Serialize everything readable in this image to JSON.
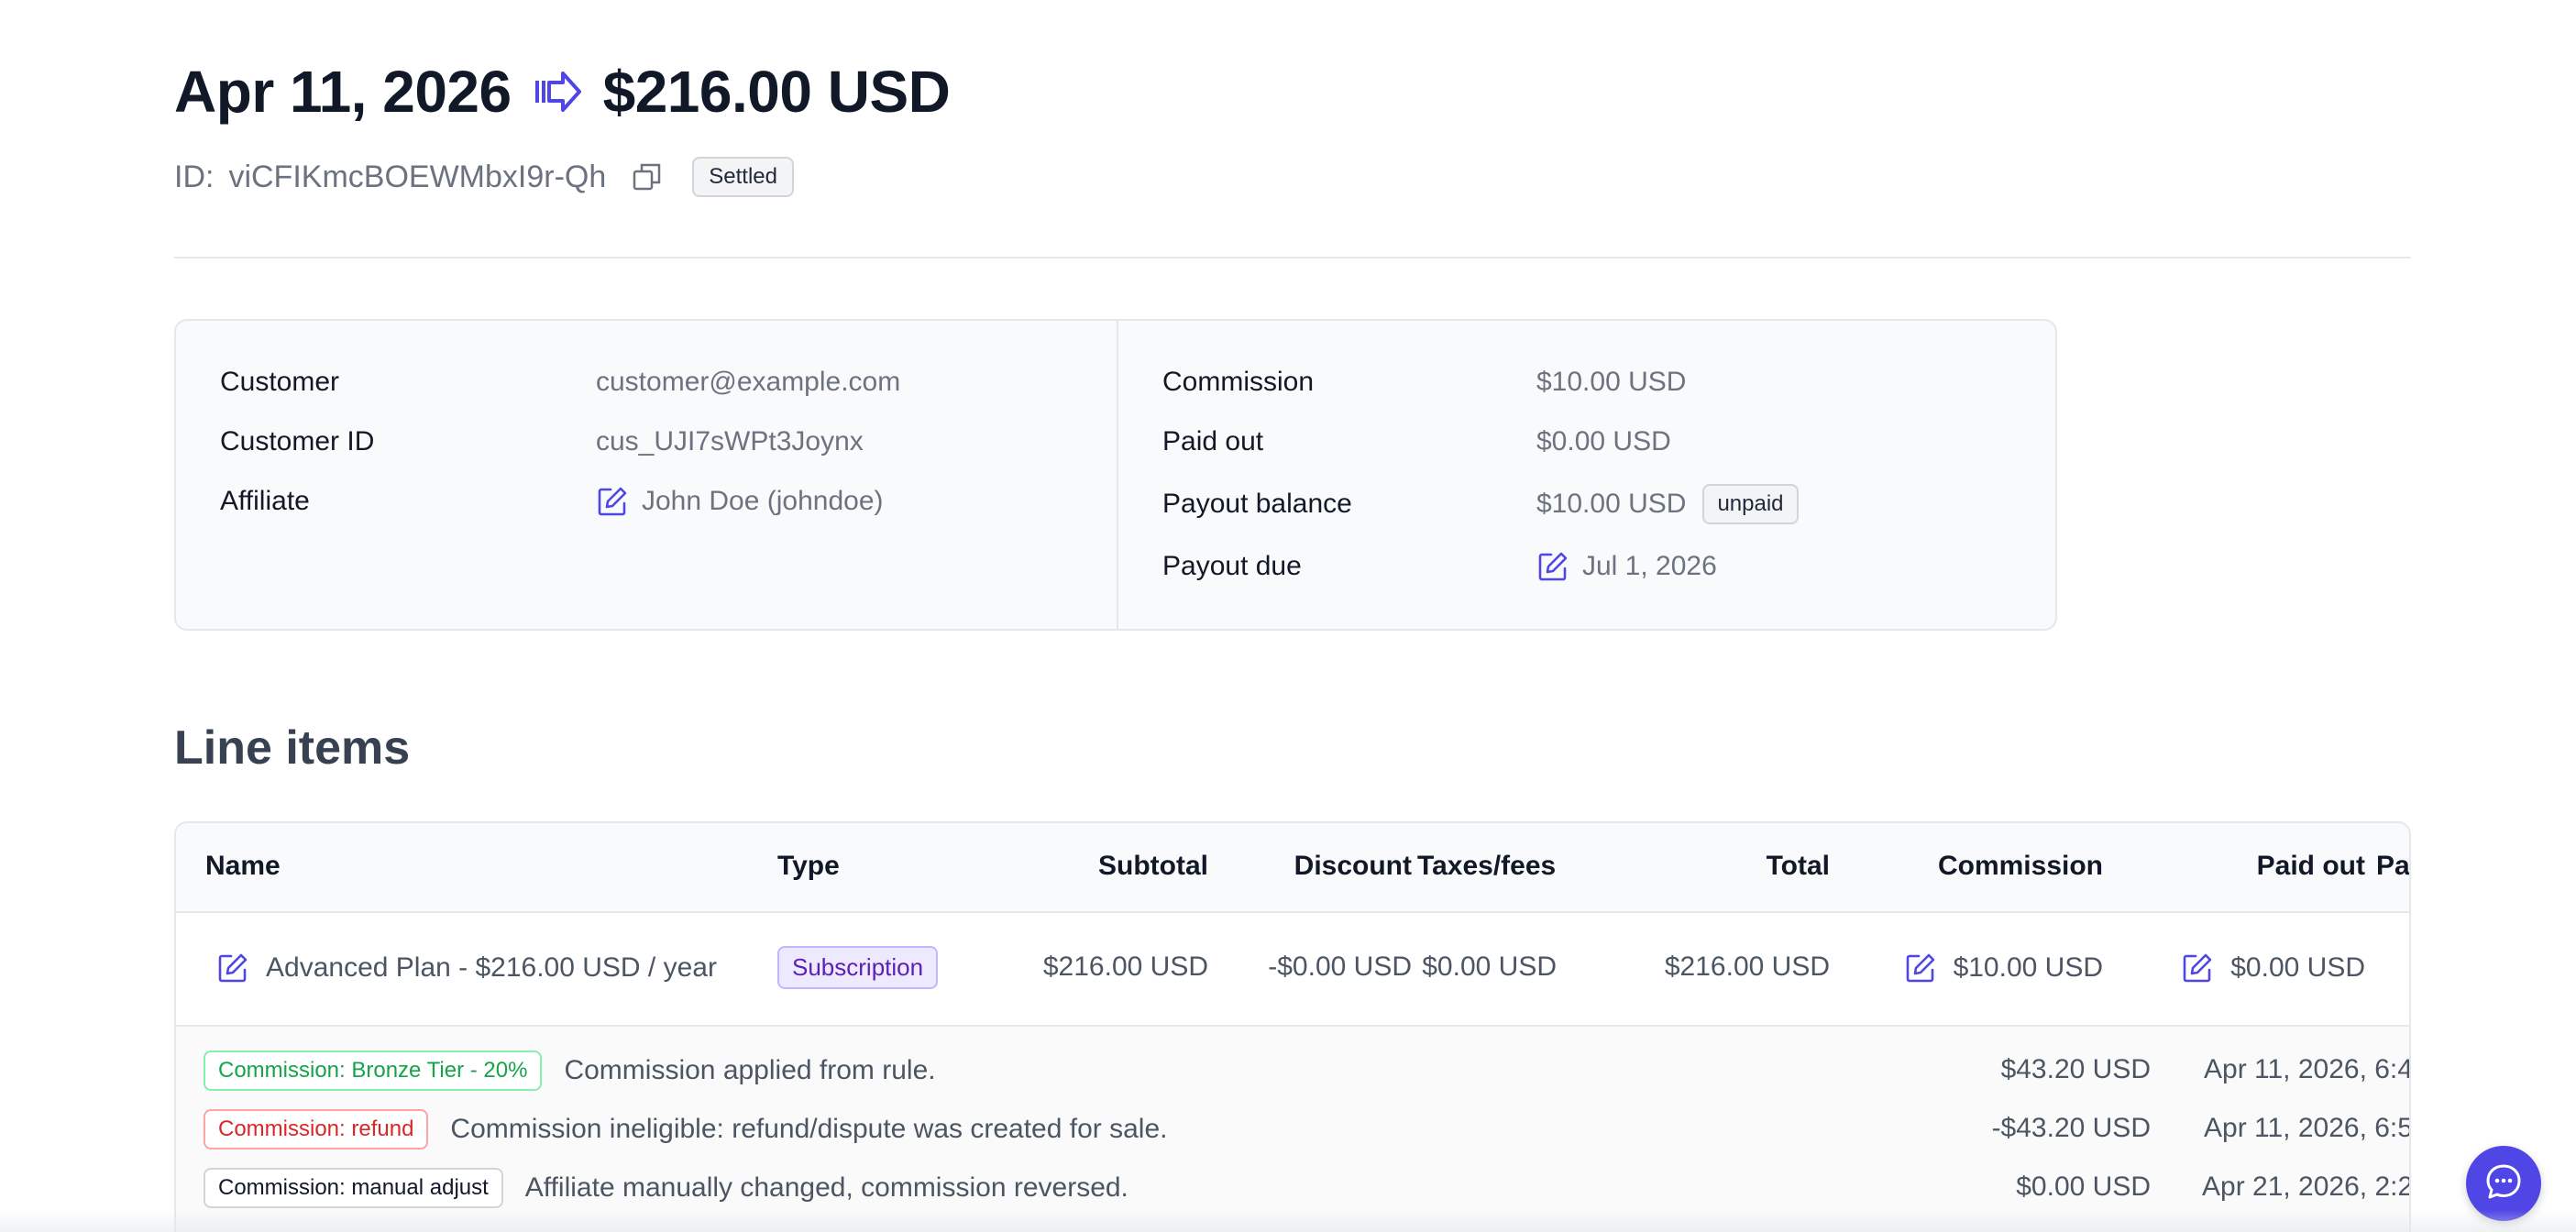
{
  "header": {
    "date": "Apr 11, 2026",
    "amount": "$216.00 USD",
    "arrow_icon": "arrow-right-icon",
    "id_label": "ID:",
    "id_value": "viCFIKmcBOEWMbxI9r-Qh",
    "status": "Settled"
  },
  "info": {
    "left": [
      {
        "key": "Customer",
        "value": "customer@example.com"
      },
      {
        "key": "Customer ID",
        "value": "cus_UJI7sWPt3Joynx"
      },
      {
        "key": "Affiliate",
        "value": "John Doe (johndoe)"
      }
    ],
    "right": [
      {
        "key": "Commission",
        "value": "$10.00 USD"
      },
      {
        "key": "Paid out",
        "value": "$0.00 USD"
      },
      {
        "key": "Payout balance",
        "value": "$10.00 USD",
        "badge": "unpaid"
      },
      {
        "key": "Payout due",
        "value": "Jul 1, 2026"
      }
    ]
  },
  "line_items": {
    "title": "Line items",
    "columns": [
      "Name",
      "Type",
      "Subtotal",
      "Discount",
      "Taxes/fees",
      "Total",
      "Commission",
      "Paid out",
      "Pay"
    ],
    "rows": [
      {
        "name": "Advanced Plan - $216.00 USD / year",
        "type": "Subscription",
        "subtotal": "$216.00 USD",
        "discount": "-$0.00 USD",
        "taxes": "$0.00 USD",
        "total": "$216.00 USD",
        "commission": "$10.00 USD",
        "paid_out": "$0.00 USD"
      }
    ],
    "details": [
      {
        "tag": "Commission: Bronze Tier - 20%",
        "text": "Commission applied from rule.",
        "amount": "$43.20 USD",
        "date": "Apr 11, 2026, 6:4"
      },
      {
        "tag": "Commission: refund",
        "text": "Commission ineligible: refund/dispute was created for sale.",
        "amount": "-$43.20 USD",
        "date": "Apr 11, 2026, 6:5"
      },
      {
        "tag": "Commission: manual adjust",
        "text": "Affiliate manually changed, commission reversed.",
        "amount": "$0.00 USD",
        "date": "Apr 21, 2026, 2:2"
      }
    ]
  },
  "colors": {
    "accent": "#4f46e5",
    "tag_green": "#16a34a",
    "tag_red": "#dc2626"
  }
}
